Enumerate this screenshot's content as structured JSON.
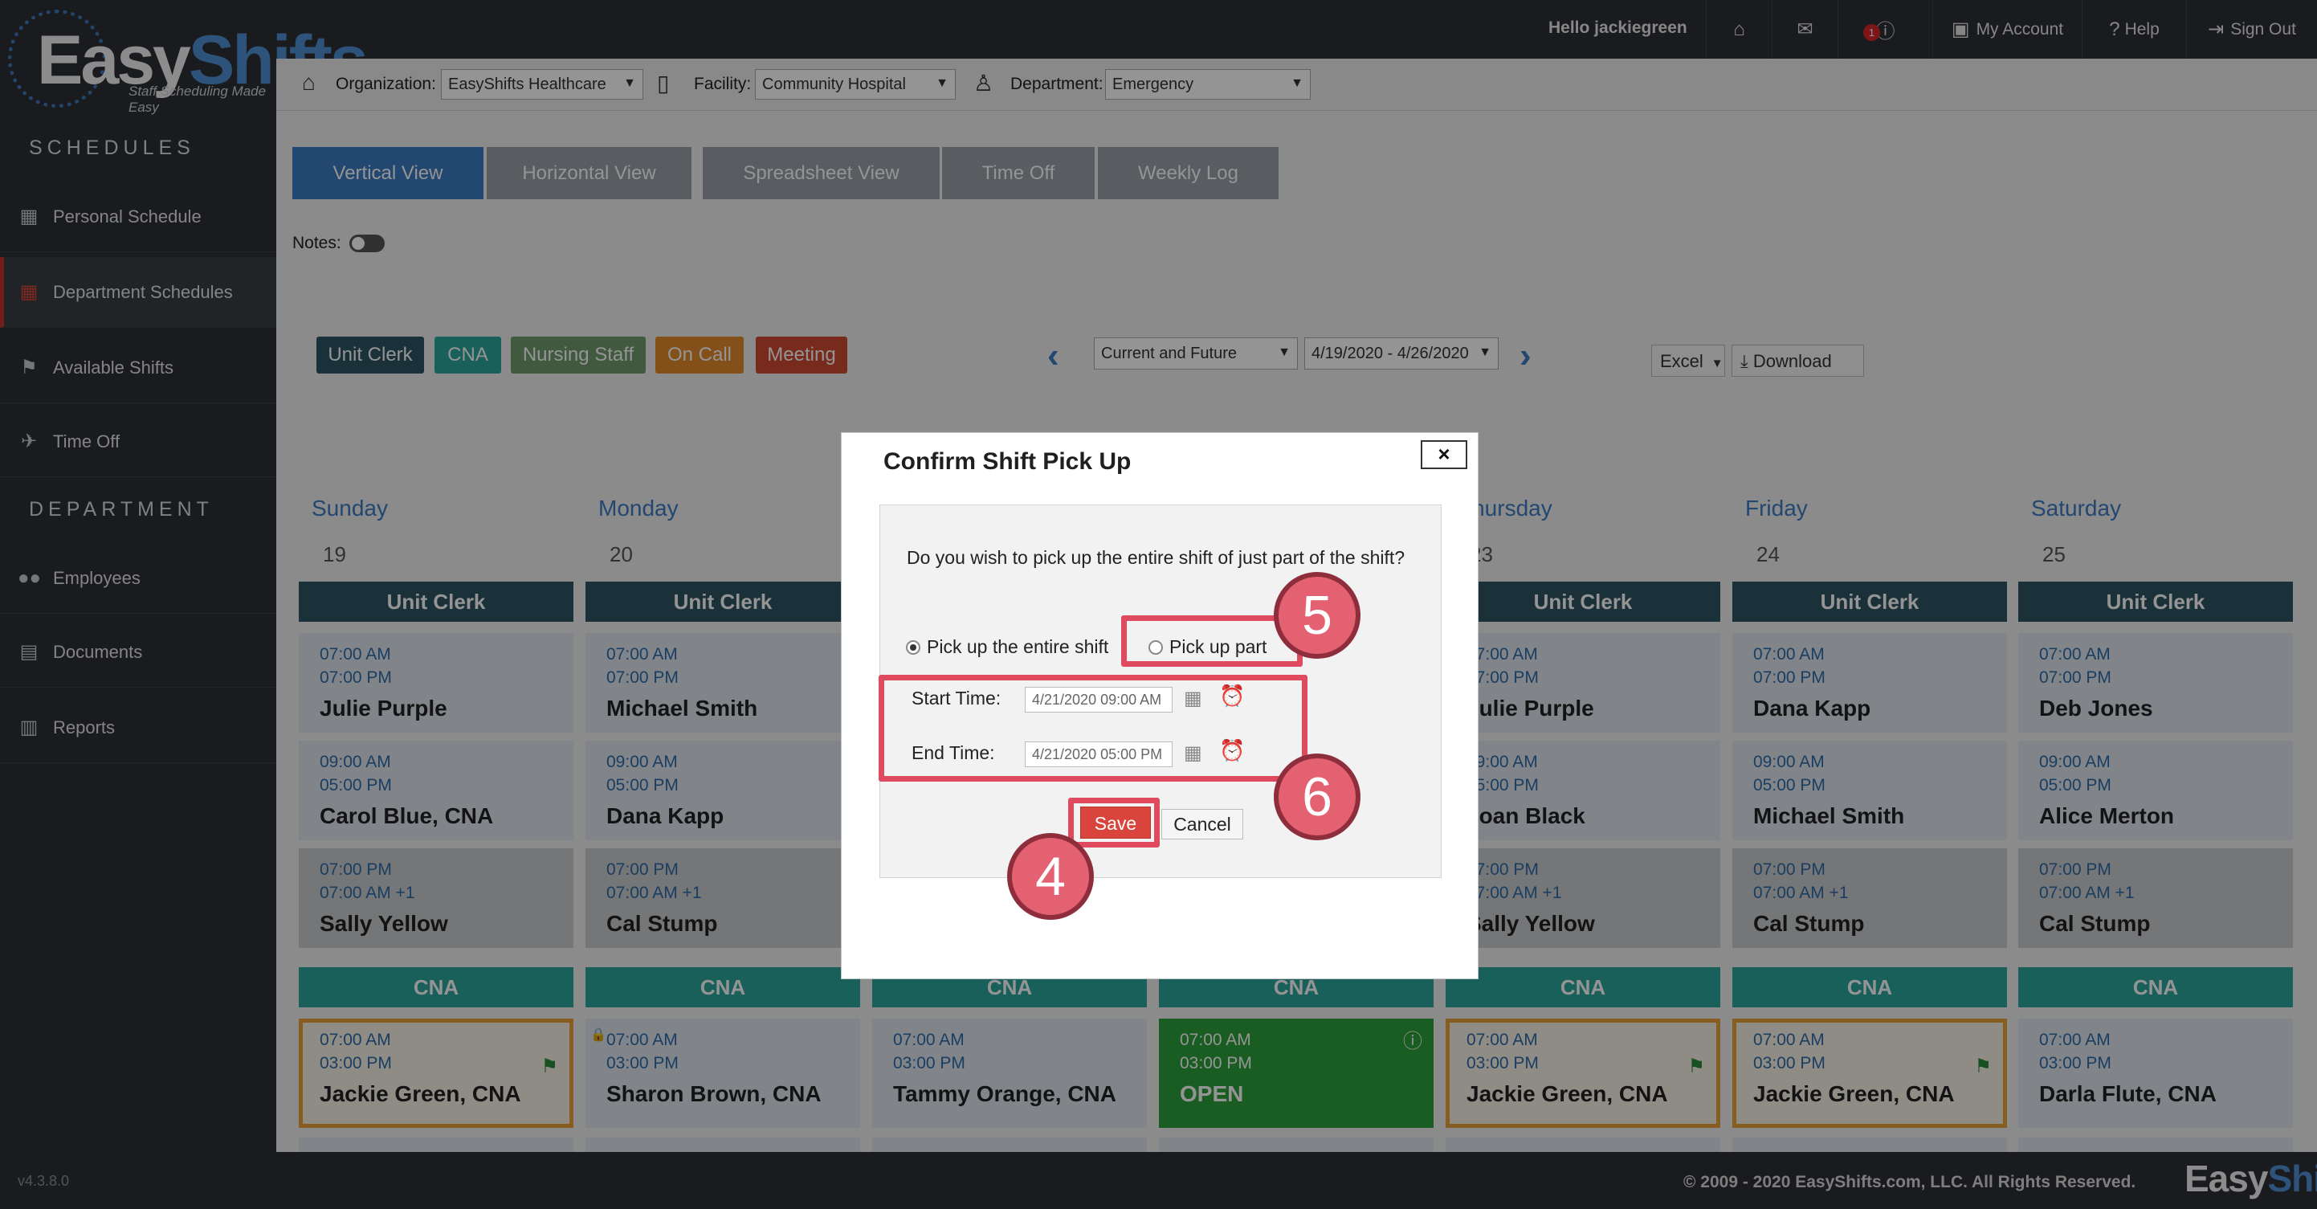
{
  "header": {
    "logo_easy": "Easy",
    "logo_shifts": "Shifts",
    "logo_tagline": "Staff Scheduling Made Easy",
    "greeting": "Hello jackiegreen",
    "notification_count": "1",
    "my_account": "My Account",
    "help": "Help",
    "sign_out": "Sign Out"
  },
  "sidebar": {
    "schedules_heading": "SCHEDULES",
    "department_heading": "DEPARTMENT",
    "items": [
      {
        "label": "Personal Schedule"
      },
      {
        "label": "Department Schedules"
      },
      {
        "label": "Available Shifts"
      },
      {
        "label": "Time Off"
      },
      {
        "label": "Employees"
      },
      {
        "label": "Documents"
      },
      {
        "label": "Reports"
      }
    ],
    "version": "v4.3.8.0"
  },
  "filters": {
    "organization_label": "Organization:",
    "organization_value": "EasyShifts Healthcare",
    "facility_label": "Facility:",
    "facility_value": "Community Hospital",
    "department_label": "Department:",
    "department_value": "Emergency"
  },
  "tabs": [
    "Vertical View",
    "Horizontal View",
    "Spreadsheet View",
    "Time Off",
    "Weekly Log"
  ],
  "notes_label": "Notes:",
  "tags": [
    {
      "label": "Unit Clerk",
      "color": "#2f5563"
    },
    {
      "label": "CNA",
      "color": "#2aa69a"
    },
    {
      "label": "Nursing Staff",
      "color": "#6f9a6d"
    },
    {
      "label": "On Call",
      "color": "#e38b2d"
    },
    {
      "label": "Meeting",
      "color": "#cf4a33"
    }
  ],
  "nav": {
    "range_filter": "Current and Future",
    "date_range": "4/19/2020 - 4/26/2020",
    "export_format": "Excel",
    "download": "Download"
  },
  "calendar": {
    "days": [
      {
        "name": "Sunday",
        "num": "19"
      },
      {
        "name": "Monday",
        "num": "20"
      },
      {
        "name": "Thursday",
        "num": "23"
      },
      {
        "name": "Friday",
        "num": "24"
      },
      {
        "name": "Saturday",
        "num": "25"
      }
    ],
    "unit_clerk_label": "Unit Clerk",
    "cna_label": "CNA",
    "uc_shifts": [
      [
        {
          "start": "07:00 AM",
          "end": "07:00 PM",
          "name": "Julie Purple"
        },
        {
          "start": "09:00 AM",
          "end": "05:00 PM",
          "name": "Carol Blue, CNA"
        },
        {
          "start": "07:00 PM",
          "end": "07:00 AM +1",
          "name": "Sally Yellow"
        }
      ],
      [
        {
          "start": "07:00 AM",
          "end": "07:00 PM",
          "name": "Michael Smith"
        },
        {
          "start": "09:00 AM",
          "end": "05:00 PM",
          "name": "Dana Kapp"
        },
        {
          "start": "07:00 PM",
          "end": "07:00 AM +1",
          "name": "Cal Stump"
        }
      ],
      [
        {
          "start": "07:00 AM",
          "end": "07:00 PM",
          "name": "Julie Purple"
        },
        {
          "start": "09:00 AM",
          "end": "05:00 PM",
          "name": "Joan Black"
        },
        {
          "start": "07:00 PM",
          "end": "07:00 AM +1",
          "name": "Sally Yellow"
        }
      ],
      [
        {
          "start": "07:00 AM",
          "end": "07:00 PM",
          "name": "Dana Kapp"
        },
        {
          "start": "09:00 AM",
          "end": "05:00 PM",
          "name": "Michael Smith"
        },
        {
          "start": "07:00 PM",
          "end": "07:00 AM +1",
          "name": "Cal Stump"
        }
      ],
      [
        {
          "start": "07:00 AM",
          "end": "07:00 PM",
          "name": "Deb Jones"
        },
        {
          "start": "09:00 AM",
          "end": "05:00 PM",
          "name": "Alice Merton"
        },
        {
          "start": "07:00 PM",
          "end": "07:00 AM +1",
          "name": "Cal Stump"
        }
      ]
    ],
    "cna_shifts": [
      {
        "start": "07:00 AM",
        "end": "03:00 PM",
        "name": "Jackie Green, CNA"
      },
      {
        "start": "07:00 AM",
        "end": "03:00 PM",
        "name": "Sharon Brown, CNA"
      },
      {
        "start": "07:00 AM",
        "end": "03:00 PM",
        "name": "Tammy Orange, CNA"
      },
      {
        "start": "07:00 AM",
        "end": "03:00 PM",
        "name": "OPEN"
      },
      {
        "start": "07:00 AM",
        "end": "03:00 PM",
        "name": "Jackie Green, CNA"
      },
      {
        "start": "07:00 AM",
        "end": "03:00 PM",
        "name": "Jackie Green, CNA"
      },
      {
        "start": "07:00 AM",
        "end": "03:00 PM",
        "name": "Darla Flute, CNA"
      }
    ]
  },
  "modal": {
    "title": "Confirm Shift Pick Up",
    "close": "×",
    "question": "Do you wish to pick up the entire shift of just part of the shift?",
    "option_entire": "Pick up the entire shift",
    "option_part": "Pick up part",
    "start_label": "Start Time:",
    "start_value": "4/21/2020 09:00 AM",
    "end_label": "End Time:",
    "end_value": "4/21/2020 05:00 PM",
    "save": "Save",
    "cancel": "Cancel"
  },
  "callouts": [
    "4",
    "5",
    "6"
  ],
  "footer": {
    "copyright": "© 2009 - 2020 EasyShifts.com, LLC. All Rights Reserved.",
    "logo_easy": "Easy",
    "logo_shifts": "Shifts"
  }
}
